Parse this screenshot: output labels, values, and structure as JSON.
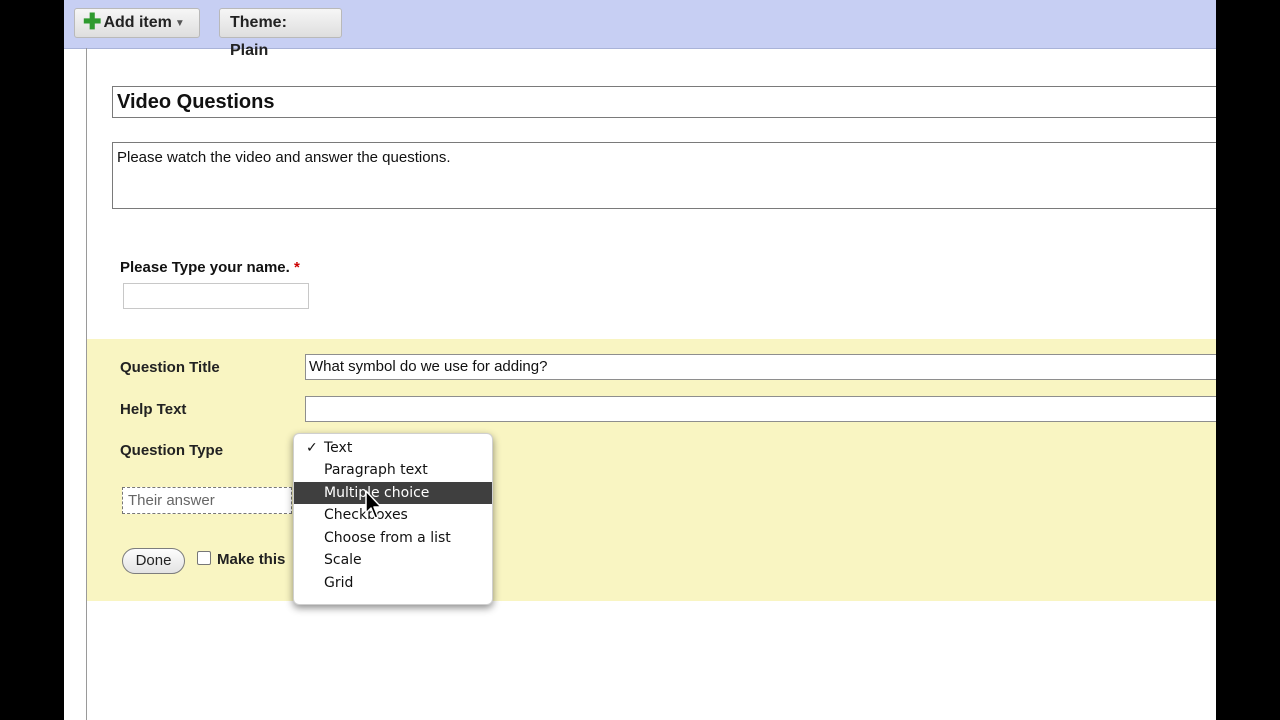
{
  "toolbar": {
    "add_item_label": "Add item",
    "theme_label": "Theme:",
    "theme_value": "Plain"
  },
  "form": {
    "title": "Video Questions",
    "description": "Please watch the video and answer the questions."
  },
  "question1": {
    "label": "Please Type your name.",
    "required_mark": "*",
    "value": ""
  },
  "editor": {
    "title_label": "Question Title",
    "title_value": "What symbol do we use for adding?",
    "help_label": "Help Text",
    "help_value": "",
    "type_label": "Question Type",
    "answer_placeholder": "Their answer",
    "done_label": "Done",
    "required_label": "Make this",
    "type_options": [
      {
        "label": "Text",
        "selected": true
      },
      {
        "label": "Paragraph text",
        "selected": false
      },
      {
        "label": "Multiple choice",
        "selected": false,
        "highlighted": true
      },
      {
        "label": "Checkboxes",
        "selected": false
      },
      {
        "label": "Choose from a list",
        "selected": false
      },
      {
        "label": "Scale",
        "selected": false
      },
      {
        "label": "Grid",
        "selected": false
      }
    ]
  },
  "icons": {
    "add": "plus-icon",
    "dropdown": "chevron-down-icon",
    "check": "checkmark-icon",
    "cursor": "mouse-pointer-icon"
  },
  "colors": {
    "toolbar_bg": "#c7cff3",
    "editor_bg": "#f9f5c2",
    "menu_highlight": "#3f3f3f",
    "add_icon": "#2e9a2e",
    "required": "#cc0000"
  }
}
